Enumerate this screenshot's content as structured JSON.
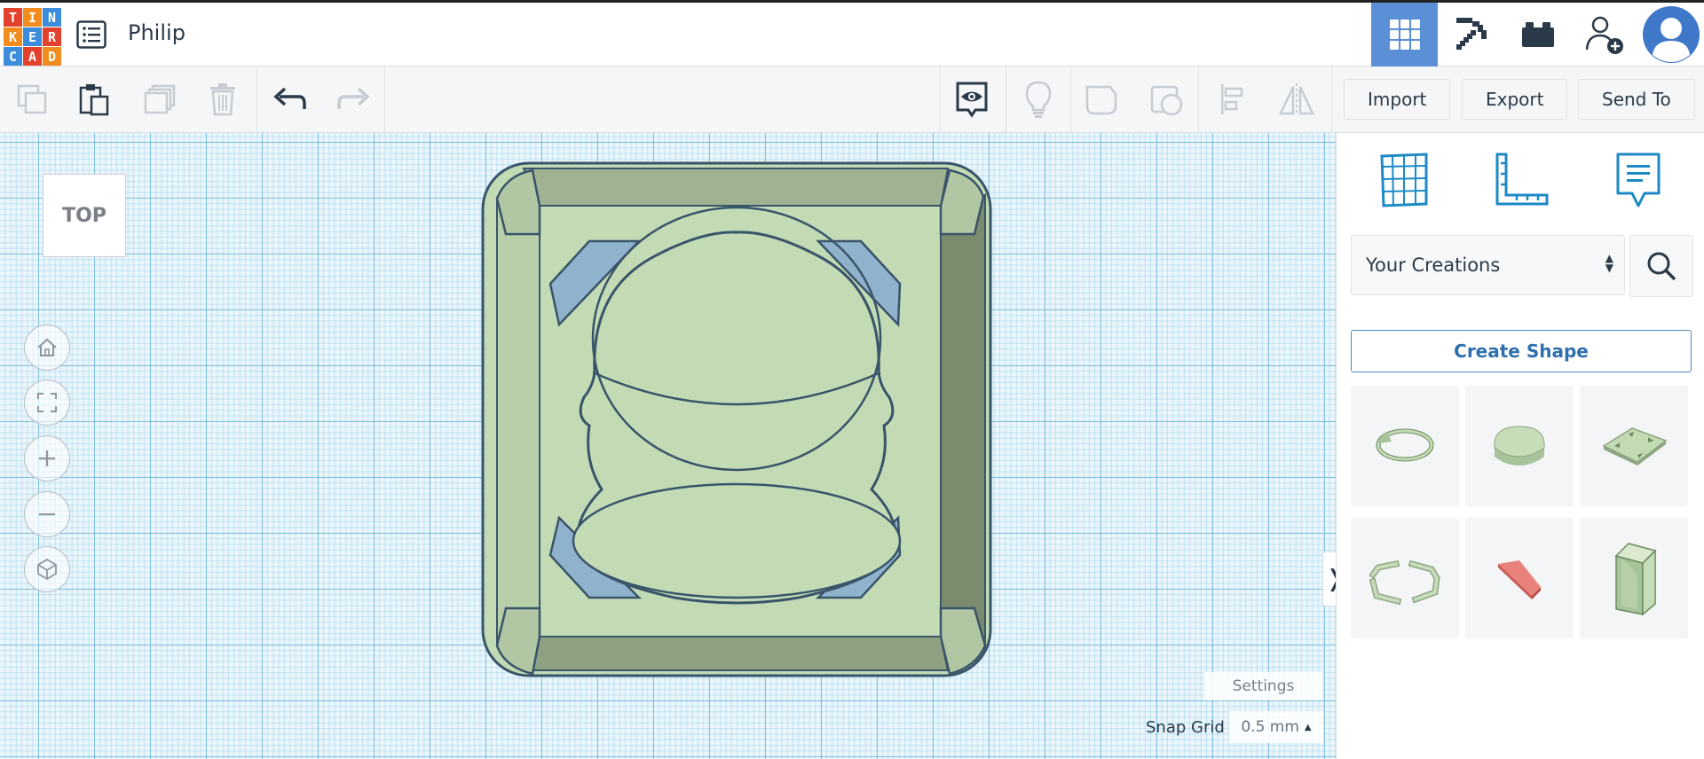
{
  "app": {
    "logo_letters": [
      "T",
      "I",
      "N",
      "K",
      "E",
      "R",
      "C",
      "A",
      "D"
    ],
    "logo_colors": [
      "#e2412b",
      "#f28c1c",
      "#3b8ddb",
      "#f28c1c",
      "#3b8ddb",
      "#e2412b",
      "#3b8ddb",
      "#e2412b",
      "#f28c1c"
    ],
    "project_name": "Philip"
  },
  "topbar": {
    "icons": [
      "grid-view-icon",
      "pickaxe-icon",
      "brick-icon",
      "add-user-icon",
      "avatar"
    ],
    "active_color": "#5b8fd6"
  },
  "toolbar": {
    "tools": [
      "copy-icon",
      "paste-icon",
      "duplicate-icon",
      "delete-icon",
      "undo-icon",
      "redo-icon",
      "notes-visibility-icon",
      "light-bulb-icon",
      "shape-solid-icon",
      "shape-hole-icon",
      "align-icon",
      "mirror-icon"
    ],
    "import_label": "Import",
    "export_label": "Export",
    "send_to_label": "Send To"
  },
  "viewport": {
    "view_cube_label": "TOP",
    "nav": [
      "home-view-icon",
      "fit-view-icon",
      "zoom-in-icon",
      "zoom-out-icon",
      "perspective-icon"
    ],
    "settings_label": "Settings",
    "snap_grid_label": "Snap Grid",
    "snap_grid_value": "0.5 mm",
    "model_color": "#c2dbb5",
    "model_outline": "#3a546a"
  },
  "panel": {
    "icons": [
      "workplane-icon",
      "ruler-icon",
      "notes-icon"
    ],
    "category": "Your Creations",
    "create_shape_label": "Create Shape",
    "shape_thumbnails": [
      "ring-shape",
      "blob-shape",
      "plate-shape",
      "frame-shape",
      "red-wedge-shape",
      "corner-wall-shape"
    ]
  }
}
